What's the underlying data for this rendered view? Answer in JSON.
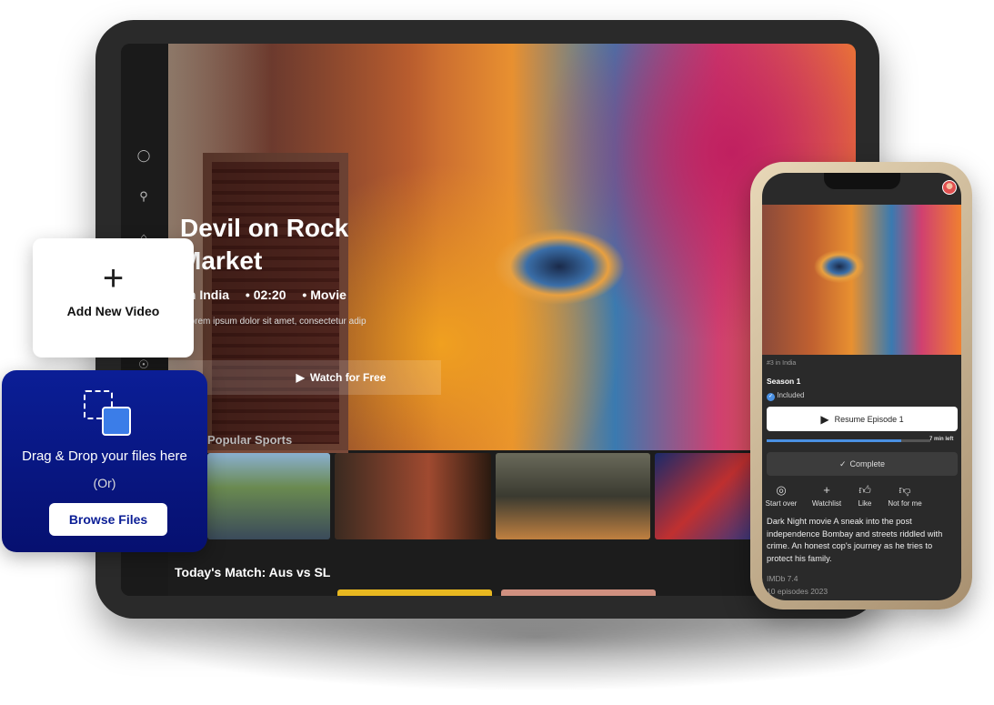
{
  "tablet": {
    "sidebar_icons": [
      "user-icon",
      "search-icon",
      "home-icon",
      "trophy-icon"
    ],
    "hero": {
      "title": "Devil on Rock Market",
      "meta": [
        "In India",
        "02:20",
        "Movie"
      ],
      "description": "Lorem ipsum dolor sit amet, consectetur adipiscing elit. Fusce vehicula non dolor Ut",
      "watch_label": "Watch for Free"
    },
    "section_title": "Popular Sports",
    "bottom_section_title": "Today's Match: Aus vs SL"
  },
  "add_card": {
    "label": "Add New Video"
  },
  "upload_card": {
    "title": "Drag & Drop your files here",
    "or": "(Or)",
    "browse_label": "Browse Files",
    "accent": "#0b1e96"
  },
  "phone": {
    "rank": "#3 in India",
    "season": "Season 1",
    "included": "Included",
    "resume_label": "Resume Episode 1",
    "progress_percent": 82,
    "time_left": "7 min left",
    "complete_label": "Complete",
    "actions": [
      {
        "label": "Start over",
        "icon": "replay-icon"
      },
      {
        "label": "Watchlist",
        "icon": "plus-icon"
      },
      {
        "label": "Like",
        "icon": "thumbs-up-icon"
      },
      {
        "label": "Not for me",
        "icon": "thumbs-down-icon"
      }
    ],
    "description": "Dark Night movie A sneak into the post independence Bombay and streets riddled with crime. An honest cop's journey as he tries to protect his family.",
    "imdb": "IMDb 7.4",
    "episodes": "10 episodes 2023"
  }
}
